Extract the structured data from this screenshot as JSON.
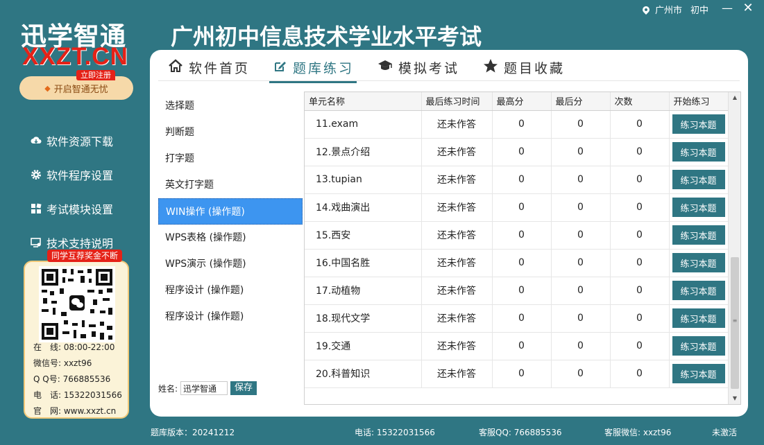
{
  "topbar": {
    "city": "广州市",
    "grade": "初中",
    "min_glyph": "—",
    "close_glyph": "✕"
  },
  "logo": {
    "cn": "迅学智通",
    "en": "XXZT.CN",
    "register": "立即注册",
    "vip": "开启智通无忧"
  },
  "app_title": "广州初中信息技术学业水平考试",
  "side_nav": [
    {
      "label": "软件资源下载",
      "icon": "cloud-download-icon"
    },
    {
      "label": "软件程序设置",
      "icon": "gear-icon"
    },
    {
      "label": "考试模块设置",
      "icon": "modules-icon"
    },
    {
      "label": "技术支持说明",
      "icon": "support-icon"
    }
  ],
  "qr_card": {
    "tag": "同学互荐奖金不断",
    "lines": [
      "在　线: 08:00-22:00",
      "微信号: xxzt96",
      "Q Q号: 766885536",
      "电　话: 15322031566",
      "官　网: www.xxzt.cn"
    ]
  },
  "tabs": [
    {
      "label": "软件首页",
      "icon": "home-icon",
      "active": false
    },
    {
      "label": "题库练习",
      "icon": "edit-icon",
      "active": true
    },
    {
      "label": "模拟考试",
      "icon": "graduation-cap-icon",
      "active": false
    },
    {
      "label": "题目收藏",
      "icon": "star-icon",
      "active": false
    }
  ],
  "categories": [
    {
      "label": "选择题",
      "selected": false
    },
    {
      "label": "判断题",
      "selected": false
    },
    {
      "label": "打字题",
      "selected": false
    },
    {
      "label": "英文打字题",
      "selected": false
    },
    {
      "label": "WIN操作 (操作题)",
      "selected": true
    },
    {
      "label": "WPS表格 (操作题)",
      "selected": false
    },
    {
      "label": "WPS演示 (操作题)",
      "selected": false
    },
    {
      "label": "程序设计 (操作题)",
      "selected": false
    },
    {
      "label": "程序设计 (操作题)",
      "selected": false
    }
  ],
  "name_form": {
    "label": "姓名:",
    "value": "迅学智通",
    "save_label": "保存"
  },
  "table": {
    "columns": [
      "单元名称",
      "最后练习时间",
      "最高分",
      "最后分",
      "次数",
      "开始练习"
    ],
    "button_label": "练习本题",
    "rows": [
      {
        "name": "11.exam",
        "last_time": "还未作答",
        "best": "0",
        "last": "0",
        "count": "0"
      },
      {
        "name": "12.景点介绍",
        "last_time": "还未作答",
        "best": "0",
        "last": "0",
        "count": "0"
      },
      {
        "name": "13.tupian",
        "last_time": "还未作答",
        "best": "0",
        "last": "0",
        "count": "0"
      },
      {
        "name": "14.戏曲演出",
        "last_time": "还未作答",
        "best": "0",
        "last": "0",
        "count": "0"
      },
      {
        "name": "15.西安",
        "last_time": "还未作答",
        "best": "0",
        "last": "0",
        "count": "0"
      },
      {
        "name": "16.中国名胜",
        "last_time": "还未作答",
        "best": "0",
        "last": "0",
        "count": "0"
      },
      {
        "name": "17.动植物",
        "last_time": "还未作答",
        "best": "0",
        "last": "0",
        "count": "0"
      },
      {
        "name": "18.现代文学",
        "last_time": "还未作答",
        "best": "0",
        "last": "0",
        "count": "0"
      },
      {
        "name": "19.交通",
        "last_time": "还未作答",
        "best": "0",
        "last": "0",
        "count": "0"
      },
      {
        "name": "20.科普知识",
        "last_time": "还未作答",
        "best": "0",
        "last": "0",
        "count": "0"
      }
    ]
  },
  "footer": {
    "version": "题库版本：20241212",
    "phone": "电话: 15322031566",
    "qq": "客服QQ: 766885536",
    "wechat": "客服微信: xxzt96",
    "status": "未激活"
  },
  "colors": {
    "brand": "#2f7683",
    "accent_red": "#e52218",
    "selected_blue": "#3d95f0"
  }
}
